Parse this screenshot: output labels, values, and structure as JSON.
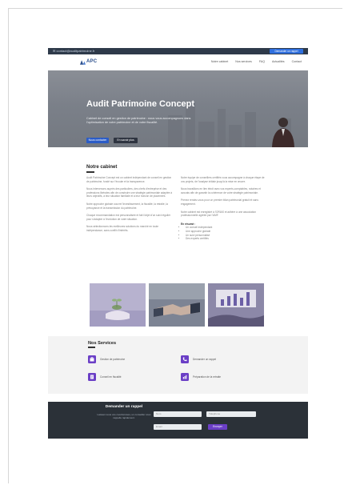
{
  "topbar": {
    "email": "✉ contact@auditpatrimoine.fr",
    "cta": "Demander un rappel"
  },
  "nav": {
    "logo": "APC",
    "menu": [
      "Notre cabinet",
      "Nos services",
      "FAQ",
      "Actualités",
      "Contact"
    ]
  },
  "hero": {
    "title": "Audit Patrimoine Concept",
    "subtitle": "Cabinet de conseil en gestion de patrimoine : nous vous accompagnons dans l'optimisation de votre patrimoine et de votre fiscalité.",
    "primary_button": "Nous contacter",
    "secondary_button": "En savoir plus"
  },
  "about": {
    "title": "Notre cabinet",
    "left_paragraphs": [
      "Audit Patrimoine Concept est un cabinet indépendant de conseil en gestion de patrimoine, fondé sur l'écoute et la transparence.",
      "Nous intervenons auprès des particuliers, des chefs d'entreprise et des professions libérales afin de construire une stratégie patrimoniale adaptée à leurs objectifs, à leur situation familiale et à leur horizon de placement.",
      "Notre approche globale couvre l'investissement, la fiscalité, la retraite, la prévoyance et la transmission du patrimoine.",
      "Chaque recommandation est personnalisée et fait l'objet d'un suivi régulier pour s'adapter à l'évolution de votre situation.",
      "Nous sélectionnons les meilleures solutions du marché en toute indépendance, sans conflit d'intérêts."
    ],
    "right_paragraphs": [
      "Notre équipe de conseillers certifiés vous accompagne à chaque étape de vos projets, de l'analyse initiale jusqu'à la mise en œuvre.",
      "Nous travaillons en lien étroit avec vos experts-comptables, notaires et avocats afin de garantir la cohérence de votre stratégie patrimoniale.",
      "Prenez rendez-vous pour un premier bilan patrimonial gratuit et sans engagement.",
      "Notre cabinet est enregistré à l'ORIAS et adhère à une association professionnelle agréée par l'AMF."
    ],
    "list_title": "En résumé :",
    "list_items": [
      "Un conseil indépendant",
      "Une approche globale",
      "Un suivi personnalisé",
      "Des experts certifiés"
    ]
  },
  "gallery": {
    "images": [
      "plant-coins-image",
      "handshake-image",
      "financial-chart-image"
    ]
  },
  "services": {
    "title": "Nos Services",
    "items": [
      {
        "label": "Gestion de patrimoine",
        "icon": "briefcase-icon"
      },
      {
        "label": "Demander un rappel",
        "icon": "phone-icon"
      },
      {
        "label": "Conseil en fiscalité",
        "icon": "document-icon"
      },
      {
        "label": "Préparation de la retraite",
        "icon": "chart-icon"
      }
    ]
  },
  "contact": {
    "title": "Demander un rappel",
    "text": "Laissez-nous vos coordonnées, un conseiller vous rappelle rapidement.",
    "fields": {
      "name": "Nom",
      "phone": "Téléphone",
      "email": "Email"
    },
    "button": "Envoyer"
  },
  "colors": {
    "accent": "#6b3fc6",
    "nav_dark": "#2e3a4a",
    "footer": "#2b3138",
    "primary_button": "#2b5cc7"
  }
}
